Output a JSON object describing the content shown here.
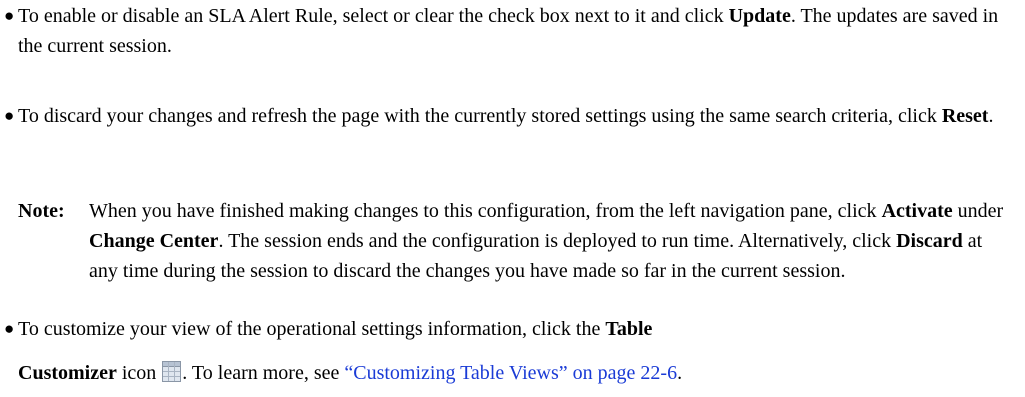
{
  "bullets": [
    {
      "pre": "To enable or disable an SLA Alert Rule, select or clear the check box next to it and click ",
      "bold": "Update",
      "post": ". The updates are saved in the current session."
    },
    {
      "pre": "To discard your changes and refresh the page with the currently stored settings using the same search criteria, click ",
      "bold": "Reset",
      "post": "."
    },
    {
      "line1_pre": "To customize your view of the operational settings information, click the ",
      "line1_bold": "Table",
      "line2_bold": "Customizer",
      "line2_mid": " icon ",
      "line2_post": ". To learn more, see ",
      "link": "“Customizing Table Views” on page 22-6",
      "link_post": "."
    }
  ],
  "note": {
    "label": "Note:",
    "t1": "When you have finished making changes to this configuration, from the left navigation pane, click ",
    "b1": "Activate",
    "t2": " under ",
    "b2": "Change Center",
    "t3": ". The session ends and the configuration is deployed to run time. Alternatively, click ",
    "b3": "Discard",
    "t4": " at any time during the session to discard the changes you have made so far in the current session."
  },
  "bullet_glyph": "●",
  "icons": {
    "table_customizer": "table-customizer-icon"
  },
  "colors": {
    "link": "#1a3bd6",
    "text": "#000000"
  }
}
